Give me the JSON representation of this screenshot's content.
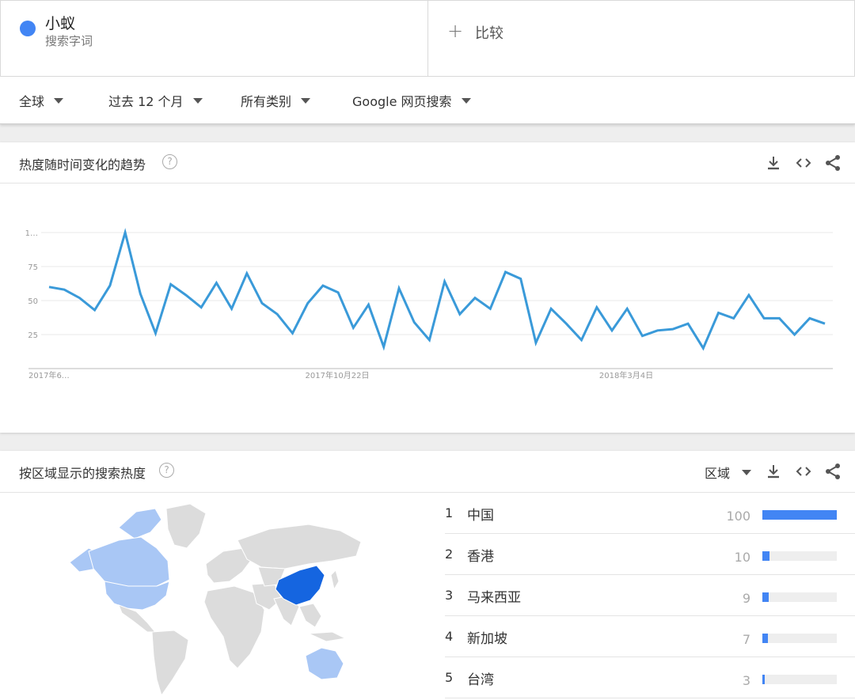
{
  "search": {
    "term_name": "小蚁",
    "term_type": "搜索字词",
    "term_color": "#4285f4",
    "compare_label": "比较"
  },
  "filters": {
    "region": "全球",
    "period": "过去 12 个月",
    "category": "所有类别",
    "search_type": "Google 网页搜索"
  },
  "trend": {
    "title": "热度随时间变化的趋势",
    "icons": [
      "help-icon",
      "download-icon",
      "embed-icon",
      "share-icon"
    ],
    "chart_data": {
      "type": "line",
      "y_tick_labels": [
        "1…",
        "75",
        "50",
        "25"
      ],
      "y_ticks": [
        100,
        75,
        50,
        25
      ],
      "ylim": [
        0,
        100
      ],
      "x_tick_labels": [
        "2017年6…",
        "2017年10月22日",
        "2018年3月4日"
      ],
      "grid": true,
      "series": [
        {
          "color": "#3a9ad9",
          "values": [
            60,
            58,
            52,
            43,
            61,
            100,
            55,
            26,
            62,
            54,
            45,
            63,
            44,
            70,
            48,
            40,
            26,
            48,
            61,
            56,
            30,
            47,
            16,
            59,
            34,
            21,
            64,
            40,
            52,
            44,
            71,
            66,
            19,
            44,
            33,
            21,
            45,
            28,
            44,
            24,
            28,
            29,
            33,
            15,
            41,
            37,
            54,
            37,
            37,
            25,
            37,
            33
          ]
        }
      ]
    }
  },
  "region_card": {
    "title": "按区域显示的搜索热度",
    "dropdown_label": "区域",
    "highlight_color": "#1565e0",
    "secondary_color": "#a9c7f5",
    "regions": [
      {
        "rank": "1",
        "name": "中国",
        "value": "100",
        "fraction": 1.0
      },
      {
        "rank": "2",
        "name": "香港",
        "value": "10",
        "fraction": 0.1
      },
      {
        "rank": "3",
        "name": "马来西亚",
        "value": "9",
        "fraction": 0.09
      },
      {
        "rank": "4",
        "name": "新加坡",
        "value": "7",
        "fraction": 0.07
      },
      {
        "rank": "5",
        "name": "台湾",
        "value": "3",
        "fraction": 0.03
      }
    ]
  }
}
